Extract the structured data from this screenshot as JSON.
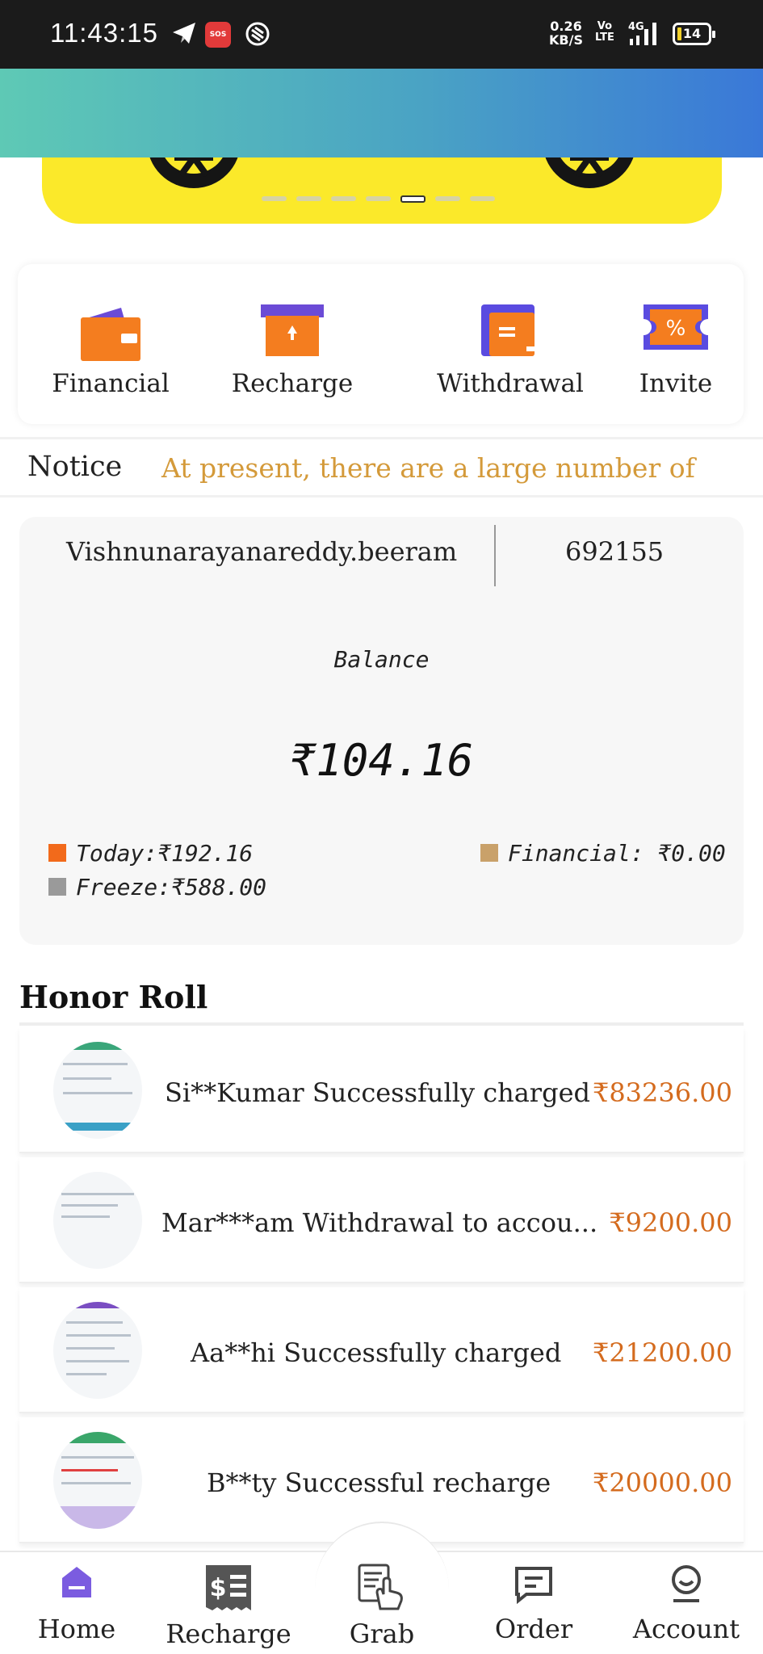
{
  "status_bar": {
    "time": "11:43:15",
    "sos": "SOS",
    "speed_value": "0.26",
    "speed_unit": "KB/S",
    "volte_top": "Vo",
    "volte_bottom": "LTE",
    "network": "4G",
    "battery": "14"
  },
  "banner": {
    "slides": 7,
    "active_slide": 5
  },
  "quick_actions": [
    {
      "label": "Financial",
      "icon": "wallet-icon"
    },
    {
      "label": "Recharge",
      "icon": "recharge-box-icon"
    },
    {
      "label": "Withdrawal",
      "icon": "withdrawal-wallet-icon"
    },
    {
      "label": "Invite",
      "icon": "coupon-percent-icon"
    }
  ],
  "notice": {
    "label": "Notice",
    "text": "At present, there are a large number of"
  },
  "account": {
    "username": "Vishnunarayanareddy.beeram",
    "id": "692155",
    "balance_label": "Balance",
    "balance": "₹104.16",
    "today": "Today:₹192.16",
    "freeze": "Freeze:₹588.00",
    "financial": "Financial: ₹0.00",
    "colors": {
      "today": "#f26a1b",
      "freeze": "#9a9a9a",
      "financial": "#c9a16a"
    }
  },
  "honor_roll": {
    "title": "Honor Roll",
    "items": [
      {
        "text": "Si**Kumar Successfully charged",
        "amount": "₹83236.00"
      },
      {
        "text": "Mar***am Withdrawal to accou...",
        "amount": "₹9200.00"
      },
      {
        "text": "Aa**hi Successfully charged",
        "amount": "₹21200.00"
      },
      {
        "text": "B**ty Successful recharge",
        "amount": "₹20000.00"
      }
    ]
  },
  "bottom_nav": [
    {
      "label": "Home",
      "icon": "home-icon",
      "active": true
    },
    {
      "label": "Recharge",
      "icon": "receipt-dollar-icon",
      "active": false
    },
    {
      "label": "Grab",
      "icon": "grab-hand-icon",
      "active": false
    },
    {
      "label": "Order",
      "icon": "order-icon",
      "active": false
    },
    {
      "label": "Account",
      "icon": "account-icon",
      "active": false
    }
  ],
  "theme": {
    "accent": "#7b5ce0",
    "amount_color": "#d46b1e",
    "notice_color": "#d49a3a"
  }
}
